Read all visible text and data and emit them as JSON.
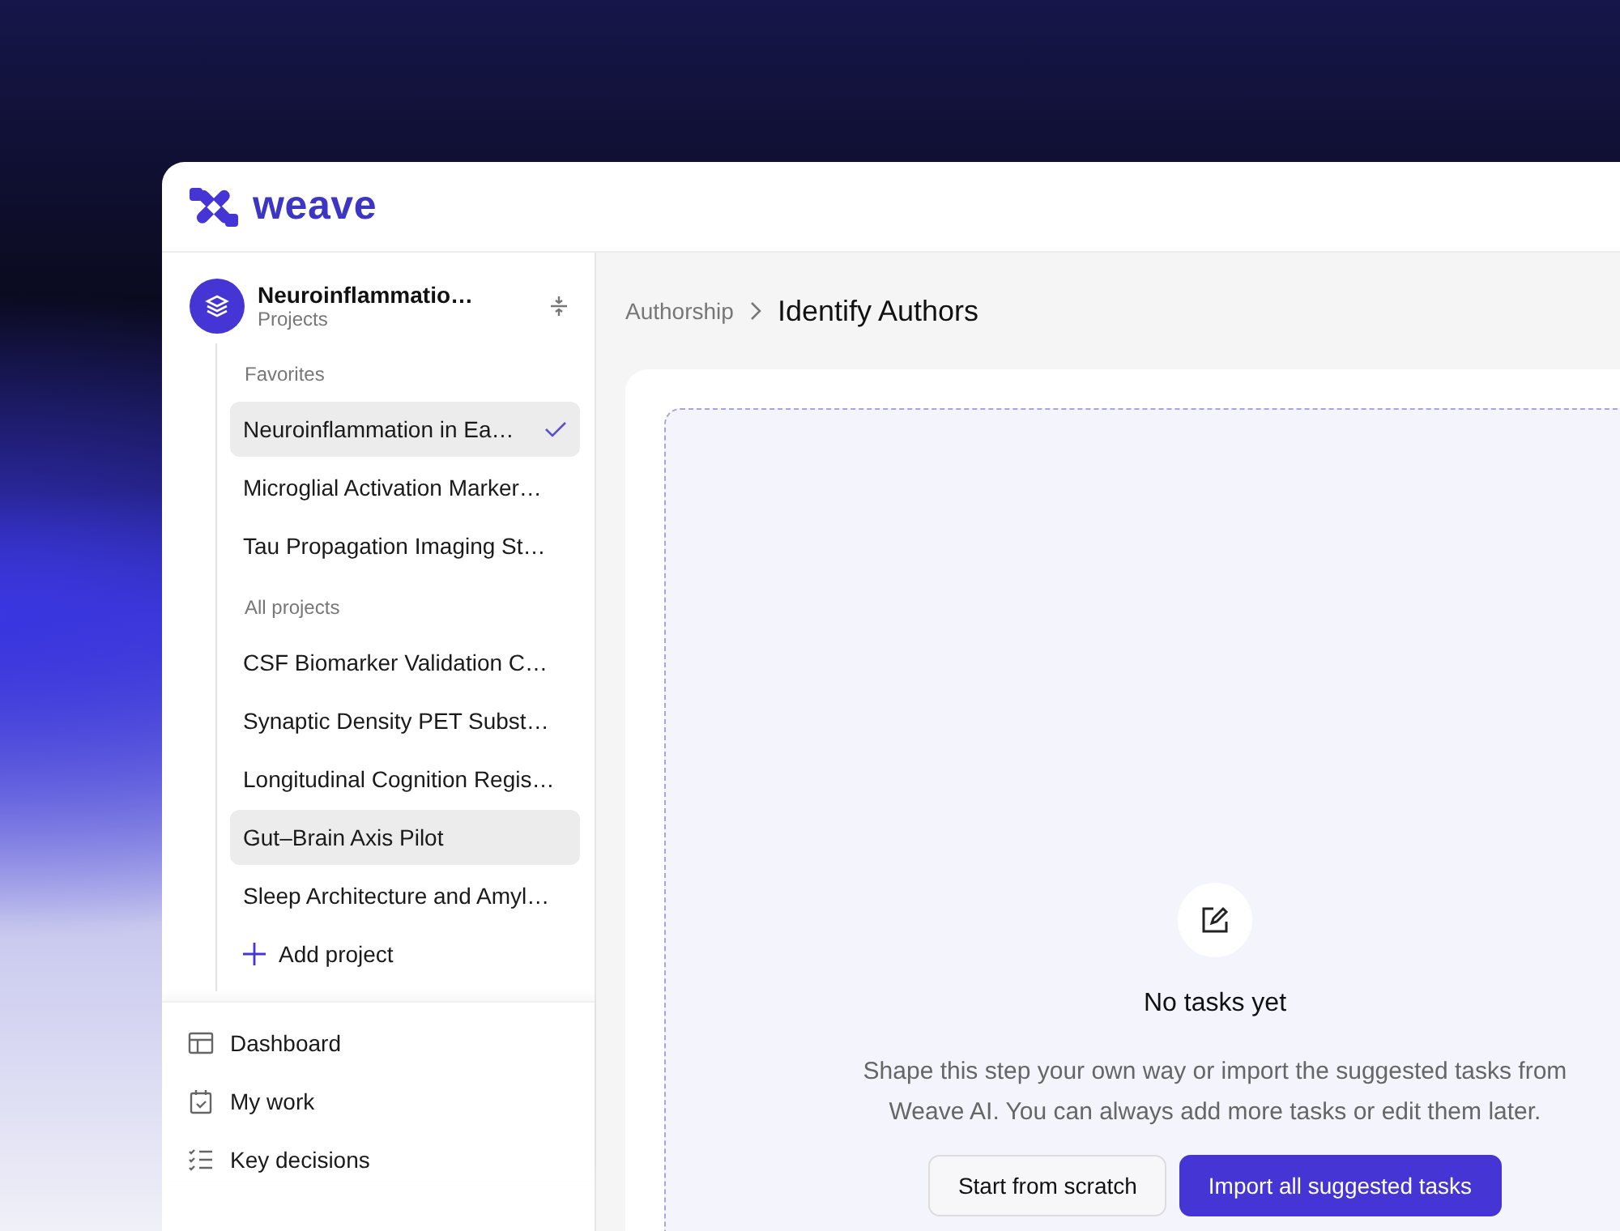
{
  "brand": {
    "name": "weave"
  },
  "sidebar": {
    "project": {
      "title": "Neuroinflammatio…",
      "subtitle": "Projects"
    },
    "sections": [
      {
        "label": "Favorites",
        "items": [
          {
            "label": "Neuroinflammation in Ea…",
            "selected": true,
            "hovered": false
          },
          {
            "label": "Microglial Activation Marker…",
            "selected": false,
            "hovered": false
          },
          {
            "label": "Tau Propagation Imaging St…",
            "selected": false,
            "hovered": false
          }
        ]
      },
      {
        "label": "All projects",
        "items": [
          {
            "label": "CSF Biomarker Validation C…",
            "selected": false,
            "hovered": false
          },
          {
            "label": "Synaptic Density PET Subst…",
            "selected": false,
            "hovered": false
          },
          {
            "label": "Longitudinal Cognition Regis…",
            "selected": false,
            "hovered": false
          },
          {
            "label": "Gut–Brain Axis Pilot",
            "selected": false,
            "hovered": true
          },
          {
            "label": "Sleep Architecture and Amyl…",
            "selected": false,
            "hovered": false
          }
        ]
      }
    ],
    "add_label": "Add project",
    "nav": [
      {
        "kind": "dashboard",
        "label": "Dashboard"
      },
      {
        "kind": "work",
        "label": "My work"
      },
      {
        "kind": "decisions",
        "label": "Key decisions"
      }
    ]
  },
  "breadcrumb": {
    "parent": "Authorship",
    "current": "Identify Authors"
  },
  "empty_state": {
    "title": "No tasks yet",
    "description": "Shape this step your own way or import the suggested tasks from\nWeave AI. You can always add more tasks or edit them later.",
    "buttons": [
      {
        "kind": "secondary",
        "label": "Start from scratch"
      },
      {
        "kind": "primary",
        "label": "Import all suggested tasks"
      }
    ]
  }
}
